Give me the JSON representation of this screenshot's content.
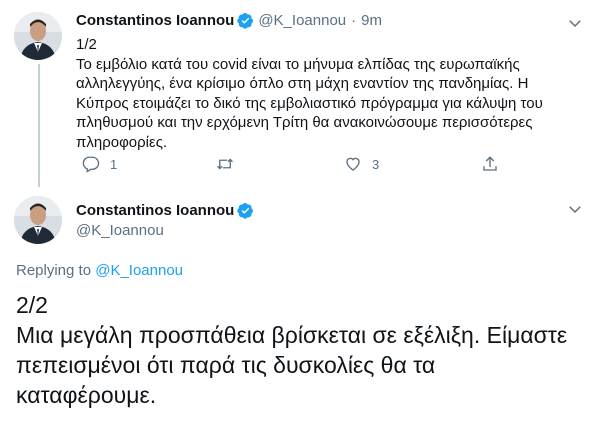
{
  "tweet1": {
    "author_name": "Constantinos Ioannou",
    "handle": "@K_Ioannou",
    "separator": "·",
    "time": "9m",
    "text_lines": [
      "1/2",
      "Το εμβόλιο κατά του covid είναι το μήνυμα ελπίδας της ευρωπαϊκής",
      "αλληλεγγύης, ένα κρίσιμο όπλο στη μάχη εναντίον της πανδημίας. Η",
      "Κύπρος ετοιμάζει το δικό της εμβολιαστικό πρόγραμμα για κάλυψη του",
      "πληθυσμού και την ερχόμενη Τρίτη θα ανακοινώσουμε περισσότερες",
      "πληροφορίες."
    ],
    "actions": {
      "reply_count": "1",
      "retweet_count": "",
      "like_count": "3",
      "share_count": ""
    }
  },
  "tweet2": {
    "author_name": "Constantinos Ioannou",
    "handle": "@K_Ioannou",
    "replying_prefix": "Replying to",
    "replying_mention": "@K_Ioannou",
    "text_lines": [
      "2/2",
      "Μια μεγάλη προσπάθεια βρίσκεται σε εξέλιξη. Είμαστε",
      "πεπεισμένοι ότι παρά τις δυσκολίες θα τα",
      "καταφέρουμε."
    ]
  },
  "colors": {
    "accent": "#1da1f2",
    "secondary_text": "#5b7083",
    "primary_text": "#0f1419",
    "thread_line": "#c4cfd6"
  },
  "icons": [
    "verified-badge-icon",
    "chevron-down-icon",
    "reply-icon",
    "retweet-icon",
    "like-icon",
    "share-icon"
  ]
}
